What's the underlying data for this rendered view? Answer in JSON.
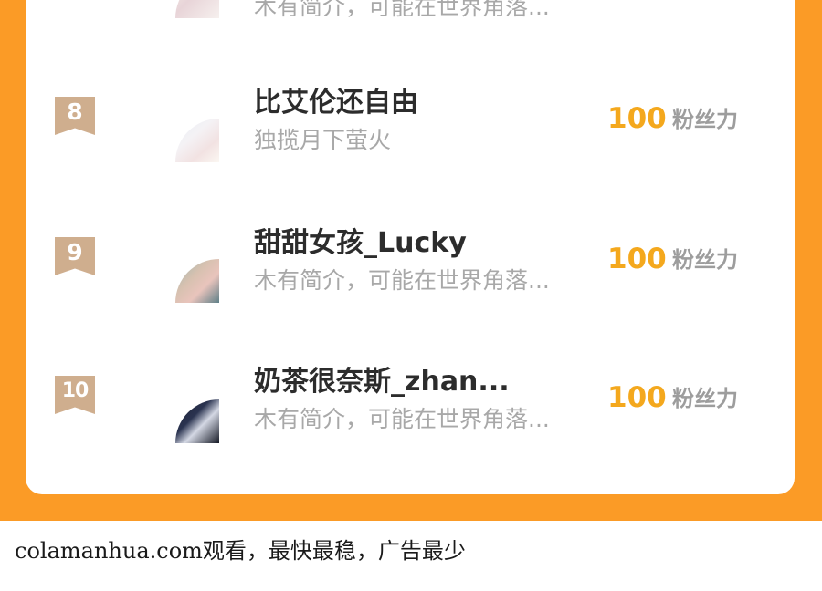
{
  "ranking": {
    "partial_row": {
      "bio": "木有简介，可能在世界角落..."
    },
    "rows": [
      {
        "rank": "8",
        "name": "比艾伦还自由",
        "bio": "独揽月下萤火",
        "score": "100",
        "unit": "粉丝力"
      },
      {
        "rank": "9",
        "name": "甜甜女孩_Lucky",
        "bio": "木有简介，可能在世界角落...",
        "score": "100",
        "unit": "粉丝力"
      },
      {
        "rank": "10",
        "name": "奶茶很奈斯_zhan...",
        "bio": "木有简介，可能在世界角落...",
        "score": "100",
        "unit": "粉丝力"
      }
    ]
  },
  "footer": {
    "text": "colamanhua.com观看，最快最稳，广告最少"
  },
  "colors": {
    "background_orange": "#fb9b26",
    "score_gold": "#f4a81d",
    "rank_badge": "#cfae8e"
  },
  "icons": {
    "rank_badge": "ribbon-badge-icon",
    "avatar": "user-avatar"
  }
}
